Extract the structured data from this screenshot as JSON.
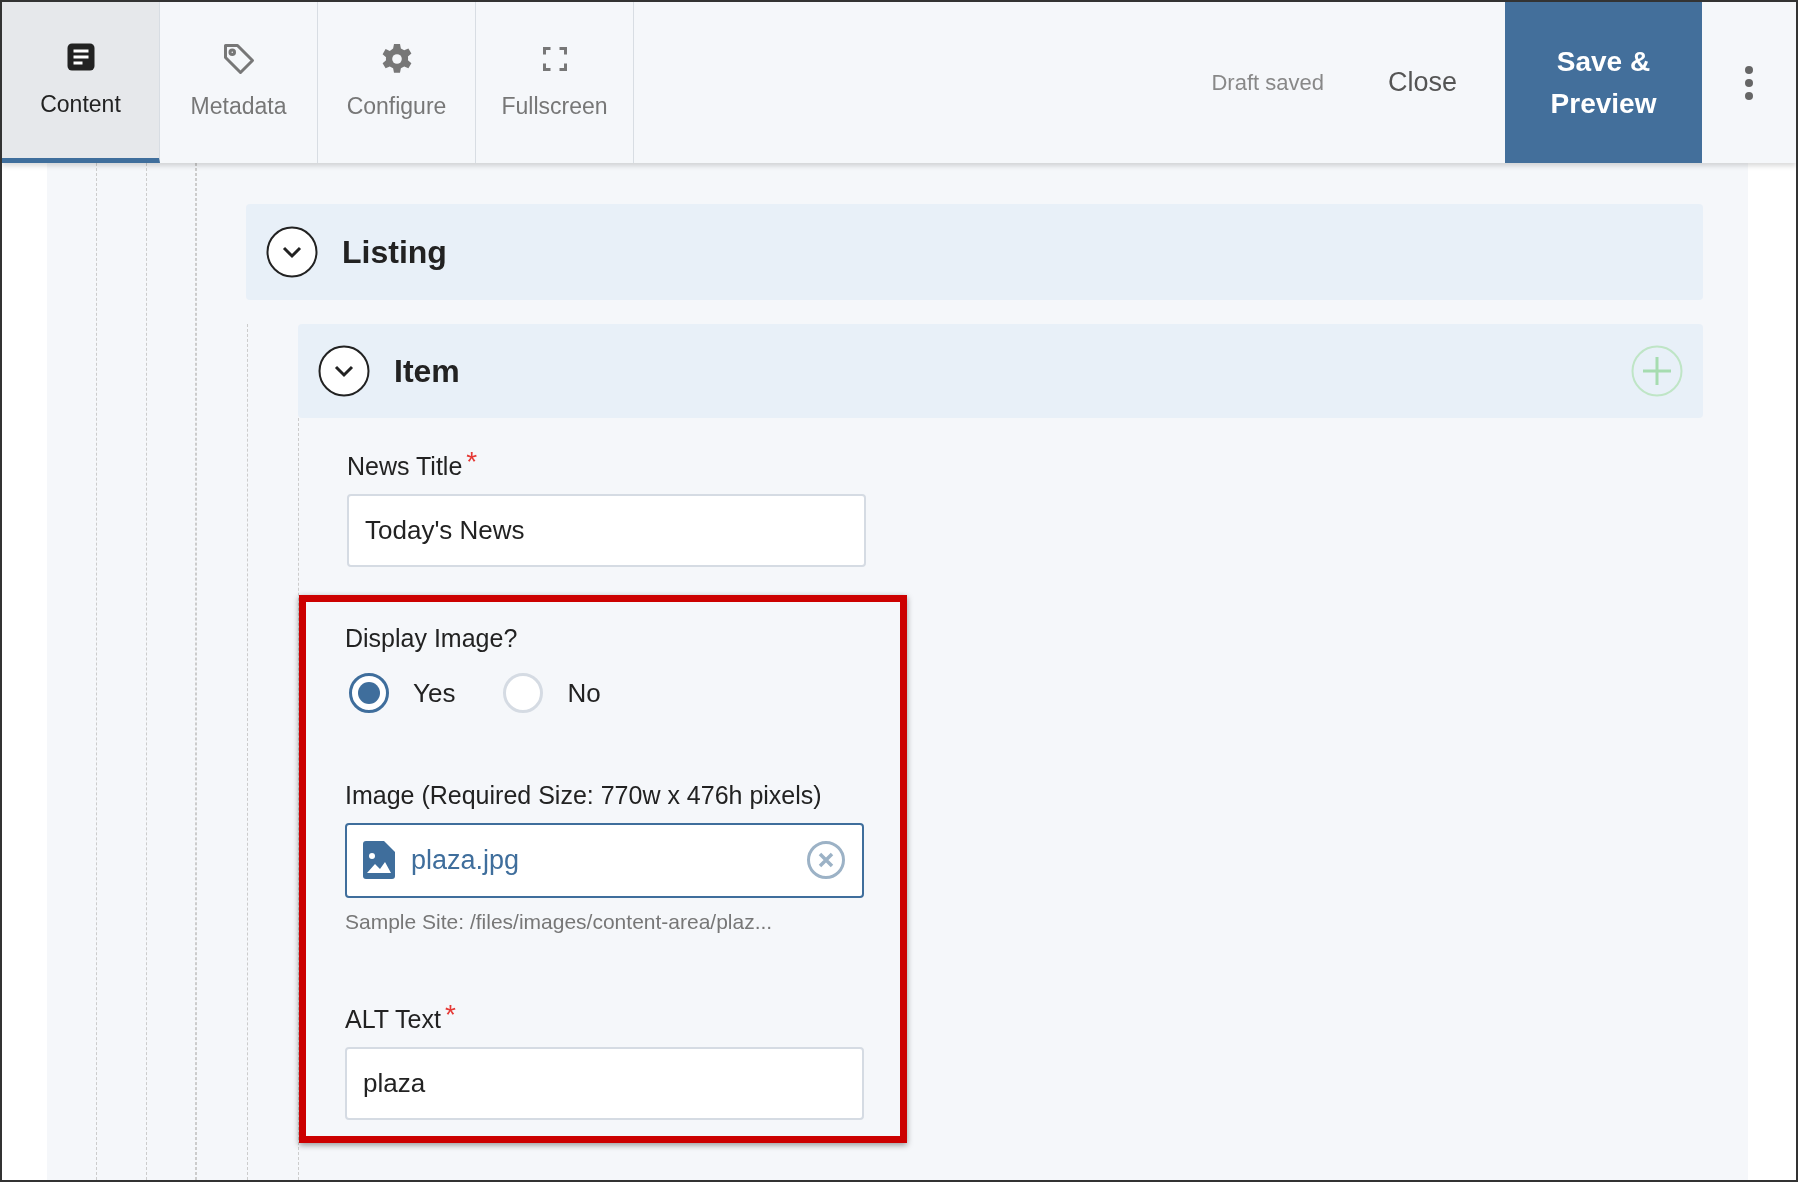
{
  "toolbar": {
    "tabs": [
      {
        "label": "Content",
        "selected": true
      },
      {
        "label": "Metadata",
        "selected": false
      },
      {
        "label": "Configure",
        "selected": false
      },
      {
        "label": "Fullscreen",
        "selected": false
      }
    ],
    "status": "Draft saved",
    "close": "Close",
    "save": "Save & Preview"
  },
  "listing": {
    "title": "Listing",
    "expanded": true
  },
  "item": {
    "title": "Item",
    "expanded": true
  },
  "fields": [
    {
      "kind": "text",
      "label": "News Title",
      "required": true,
      "required_mark": "*",
      "value": "Today's News",
      "highlighted": false
    },
    {
      "kind": "radio",
      "label": "Display Image?",
      "highlighted": true,
      "options": [
        {
          "label": "Yes",
          "selected": true
        },
        {
          "label": "No",
          "selected": false
        }
      ]
    },
    {
      "kind": "file",
      "label": "Image (Required Size: 770w x 476h pixels)",
      "highlighted": true,
      "value": "plaza.jpg",
      "path": "Sample Site: /files/images/content-area/plaz..."
    },
    {
      "kind": "text",
      "label": "ALT Text",
      "required": true,
      "required_mark": "*",
      "value": "plaza",
      "highlighted": true
    }
  ]
}
